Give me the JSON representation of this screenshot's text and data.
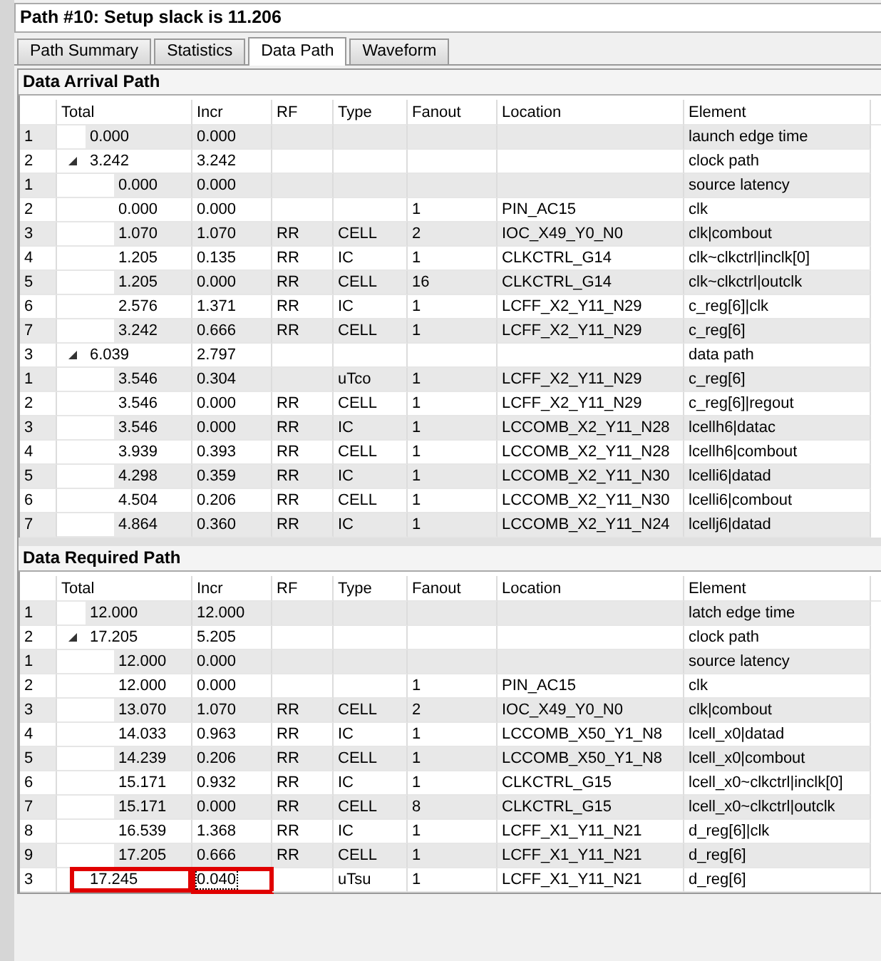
{
  "title": "Path #10: Setup slack is 11.206",
  "tabs": [
    {
      "label": "Path Summary",
      "selected": false
    },
    {
      "label": "Statistics",
      "selected": false
    },
    {
      "label": "Data Path",
      "selected": true
    },
    {
      "label": "Waveform",
      "selected": false
    }
  ],
  "sections": [
    {
      "title": "Data Arrival Path",
      "columns": [
        "Total",
        "Incr",
        "RF",
        "Type",
        "Fanout",
        "Location",
        "Element"
      ],
      "rows": [
        {
          "num": "1",
          "total": "0.000",
          "incr": "0.000",
          "element": "launch edge time",
          "highlighted": false
        },
        {
          "num": "2",
          "total": "3.242",
          "incr": "3.242",
          "element": "clock path",
          "highlighted": false,
          "expanded": true,
          "children": [
            {
              "num": "1",
              "total": "0.000",
              "incr": "0.000",
              "element": "source latency",
              "highlighted": false
            },
            {
              "num": "2",
              "total": "0.000",
              "incr": "0.000",
              "fanout": "1",
              "location": "PIN_AC15",
              "element": "clk",
              "highlighted": false
            },
            {
              "num": "3",
              "total": "1.070",
              "incr": "1.070",
              "rf": "RR",
              "type": "CELL",
              "fanout": "2",
              "location": "IOC_X49_Y0_N0",
              "element": "clk|combout",
              "highlighted": false
            },
            {
              "num": "4",
              "total": "1.205",
              "incr": "0.135",
              "rf": "RR",
              "type": "IC",
              "fanout": "1",
              "location": "CLKCTRL_G14",
              "element": "clk~clkctrl|inclk[0]",
              "highlighted": false
            },
            {
              "num": "5",
              "total": "1.205",
              "incr": "0.000",
              "rf": "RR",
              "type": "CELL",
              "fanout": "16",
              "location": "CLKCTRL_G14",
              "element": "clk~clkctrl|outclk",
              "highlighted": false
            },
            {
              "num": "6",
              "total": "2.576",
              "incr": "1.371",
              "rf": "RR",
              "type": "IC",
              "fanout": "1",
              "location": "LCFF_X2_Y11_N29",
              "element": "c_reg[6]|clk",
              "highlighted": false
            },
            {
              "num": "7",
              "total": "3.242",
              "incr": "0.666",
              "rf": "RR",
              "type": "CELL",
              "fanout": "1",
              "location": "LCFF_X2_Y11_N29",
              "element": "c_reg[6]",
              "highlighted": false
            }
          ]
        },
        {
          "num": "3",
          "total": "6.039",
          "incr": "2.797",
          "element": "data path",
          "highlighted": false,
          "expanded": true,
          "children": [
            {
              "num": "1",
              "total": "3.546",
              "incr": "0.304",
              "type": "uTco",
              "fanout": "1",
              "location": "LCFF_X2_Y11_N29",
              "element": "c_reg[6]",
              "highlighted": false
            },
            {
              "num": "2",
              "total": "3.546",
              "incr": "0.000",
              "rf": "RR",
              "type": "CELL",
              "fanout": "1",
              "location": "LCFF_X2_Y11_N29",
              "element": "c_reg[6]|regout",
              "highlighted": false
            },
            {
              "num": "3",
              "total": "3.546",
              "incr": "0.000",
              "rf": "RR",
              "type": "IC",
              "fanout": "1",
              "location": "LCCOMB_X2_Y11_N28",
              "element": "lcellh6|datac",
              "highlighted": false
            },
            {
              "num": "4",
              "total": "3.939",
              "incr": "0.393",
              "rf": "RR",
              "type": "CELL",
              "fanout": "1",
              "location": "LCCOMB_X2_Y11_N28",
              "element": "lcellh6|combout",
              "highlighted": false
            },
            {
              "num": "5",
              "total": "4.298",
              "incr": "0.359",
              "rf": "RR",
              "type": "IC",
              "fanout": "1",
              "location": "LCCOMB_X2_Y11_N30",
              "element": "lcelli6|datad",
              "highlighted": false
            },
            {
              "num": "6",
              "total": "4.504",
              "incr": "0.206",
              "rf": "RR",
              "type": "CELL",
              "fanout": "1",
              "location": "LCCOMB_X2_Y11_N30",
              "element": "lcelli6|combout",
              "highlighted": false
            },
            {
              "num": "7",
              "total": "4.864",
              "incr": "0.360",
              "rf": "RR",
              "type": "IC",
              "fanout": "1",
              "location": "LCCOMB_X2_Y11_N24",
              "element": "lcellj6|datad",
              "highlighted": false
            }
          ]
        }
      ]
    },
    {
      "title": "Data Required Path",
      "columns": [
        "Total",
        "Incr",
        "RF",
        "Type",
        "Fanout",
        "Location",
        "Element"
      ],
      "rows": [
        {
          "num": "1",
          "total": "12.000",
          "incr": "12.000",
          "element": "latch edge time",
          "highlighted": false
        },
        {
          "num": "2",
          "total": "17.205",
          "incr": "5.205",
          "element": "clock path",
          "highlighted": false,
          "expanded": true,
          "children": [
            {
              "num": "1",
              "total": "12.000",
              "incr": "0.000",
              "element": "source latency",
              "highlighted": false
            },
            {
              "num": "2",
              "total": "12.000",
              "incr": "0.000",
              "fanout": "1",
              "location": "PIN_AC15",
              "element": "clk",
              "highlighted": false
            },
            {
              "num": "3",
              "total": "13.070",
              "incr": "1.070",
              "rf": "RR",
              "type": "CELL",
              "fanout": "2",
              "location": "IOC_X49_Y0_N0",
              "element": "clk|combout",
              "highlighted": false
            },
            {
              "num": "4",
              "total": "14.033",
              "incr": "0.963",
              "rf": "RR",
              "type": "IC",
              "fanout": "1",
              "location": "LCCOMB_X50_Y1_N8",
              "element": "lcell_x0|datad",
              "highlighted": false
            },
            {
              "num": "5",
              "total": "14.239",
              "incr": "0.206",
              "rf": "RR",
              "type": "CELL",
              "fanout": "1",
              "location": "LCCOMB_X50_Y1_N8",
              "element": "lcell_x0|combout",
              "highlighted": false
            },
            {
              "num": "6",
              "total": "15.171",
              "incr": "0.932",
              "rf": "RR",
              "type": "IC",
              "fanout": "1",
              "location": "CLKCTRL_G15",
              "element": "lcell_x0~clkctrl|inclk[0]",
              "highlighted": false
            },
            {
              "num": "7",
              "total": "15.171",
              "incr": "0.000",
              "rf": "RR",
              "type": "CELL",
              "fanout": "8",
              "location": "CLKCTRL_G15",
              "element": "lcell_x0~clkctrl|outclk",
              "highlighted": false
            },
            {
              "num": "8",
              "total": "16.539",
              "incr": "1.368",
              "rf": "RR",
              "type": "IC",
              "fanout": "1",
              "location": "LCFF_X1_Y11_N21",
              "element": "d_reg[6]|clk",
              "highlighted": false
            },
            {
              "num": "9",
              "total": "17.205",
              "incr": "0.666",
              "rf": "RR",
              "type": "CELL",
              "fanout": "1",
              "location": "LCFF_X1_Y11_N21",
              "element": "d_reg[6]",
              "highlighted": false
            }
          ]
        },
        {
          "num": "3",
          "total": "17.245",
          "incr": "0.040",
          "type": "uTsu",
          "fanout": "1",
          "location": "LCFF_X1_Y11_N21",
          "element": "d_reg[6]",
          "highlighted": true
        }
      ]
    }
  ]
}
